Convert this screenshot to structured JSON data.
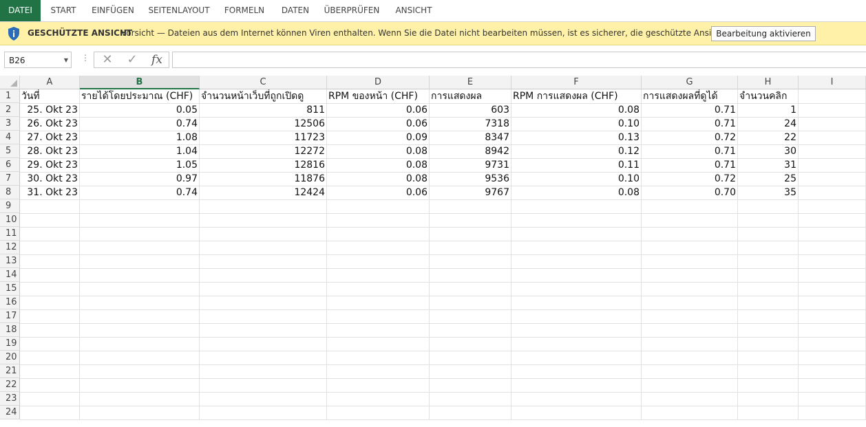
{
  "ribbon": {
    "tabs": [
      {
        "label": "DATEI",
        "active": true
      },
      {
        "label": "START"
      },
      {
        "label": "EINFÜGEN"
      },
      {
        "label": "SEITENLAYOUT"
      },
      {
        "label": "FORMELN"
      },
      {
        "label": "DATEN"
      },
      {
        "label": "ÜBERPRÜFEN"
      },
      {
        "label": "ANSICHT"
      }
    ]
  },
  "protected_view": {
    "icon": "shield-info-icon",
    "title": "GESCHÜTZTE ANSICHT",
    "message": "Vorsicht — Dateien aus dem Internet können Viren enthalten. Wenn Sie die Datei nicht bearbeiten müssen, ist es sicherer, die geschützte Ansicht beizubehalten.",
    "button": "Bearbeitung aktivieren"
  },
  "formula_bar": {
    "name_box": "B26",
    "value": ""
  },
  "sheet": {
    "columns": [
      "A",
      "B",
      "C",
      "D",
      "E",
      "F",
      "G",
      "H",
      "I"
    ],
    "selected_column": "B",
    "row_numbers": [
      "1",
      "2",
      "3",
      "4",
      "5",
      "6",
      "7",
      "8",
      "9",
      "10",
      "11",
      "12",
      "13",
      "14",
      "15",
      "16",
      "17",
      "18",
      "19",
      "20",
      "21",
      "22",
      "23",
      "24"
    ],
    "rows": [
      [
        "วันที่",
        "รายได้โดยประมาณ (CHF)",
        "จำนวนหน้าเว็บที่ถูกเปิดดู",
        "RPM ของหน้า (CHF)",
        "การแสดงผล",
        "RPM การแสดงผล (CHF)",
        "การแสดงผลที่ดูได้",
        "จำนวนคลิก"
      ],
      [
        "25. Okt 23",
        "0.05",
        "811",
        "0.06",
        "603",
        "0.08",
        "0.71",
        "1"
      ],
      [
        "26. Okt 23",
        "0.74",
        "12506",
        "0.06",
        "7318",
        "0.10",
        "0.71",
        "24"
      ],
      [
        "27. Okt 23",
        "1.08",
        "11723",
        "0.09",
        "8347",
        "0.13",
        "0.72",
        "22"
      ],
      [
        "28. Okt 23",
        "1.04",
        "12272",
        "0.08",
        "8942",
        "0.12",
        "0.71",
        "30"
      ],
      [
        "29. Okt 23",
        "1.05",
        "12816",
        "0.08",
        "9731",
        "0.11",
        "0.71",
        "31"
      ],
      [
        "30. Okt 23",
        "0.97",
        "11876",
        "0.08",
        "9536",
        "0.10",
        "0.72",
        "25"
      ],
      [
        "31. Okt 23",
        "0.74",
        "12424",
        "0.06",
        "9767",
        "0.08",
        "0.70",
        "35"
      ]
    ]
  },
  "colors": {
    "accent": "#217346",
    "warning_bar": "#fff1a8",
    "shield": "#2b6cb8"
  }
}
